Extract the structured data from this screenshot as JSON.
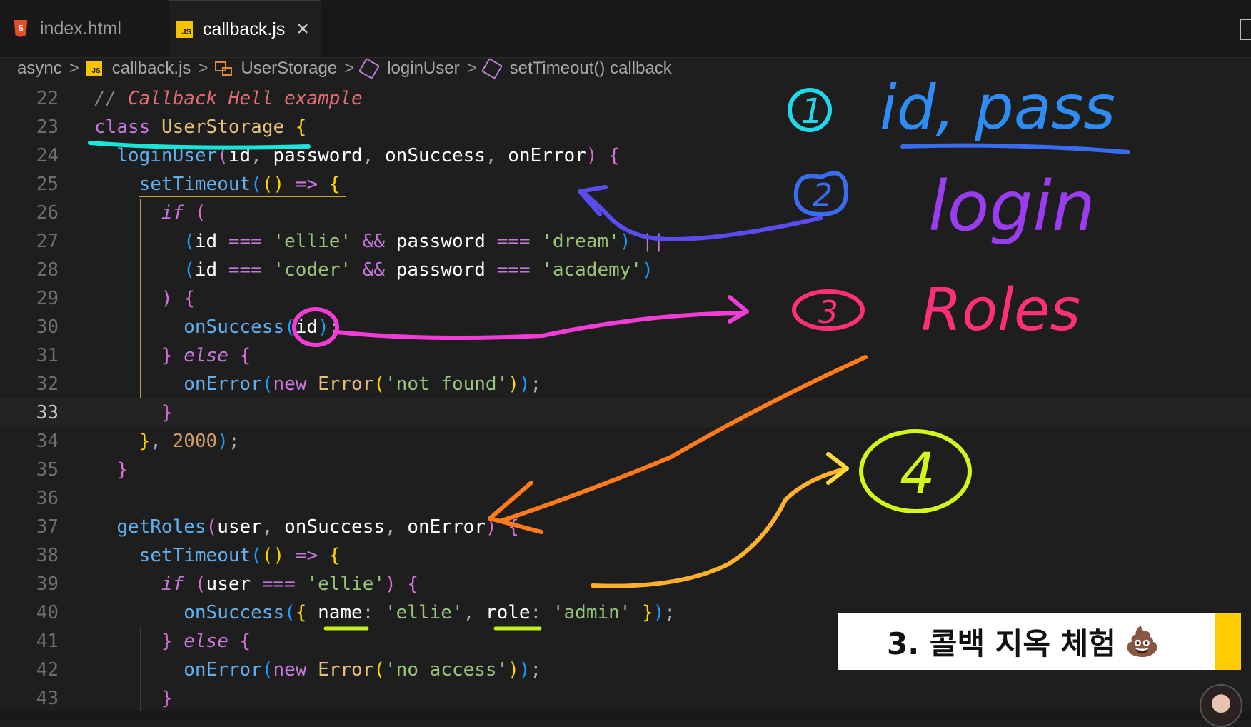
{
  "tabs": [
    {
      "label": "index.html",
      "icon": "html5-icon",
      "active": false
    },
    {
      "label": "callback.js",
      "icon": "js-file-icon",
      "active": true,
      "close": "×"
    }
  ],
  "breadcrumb": {
    "folder": "async",
    "file": "callback.js",
    "class_name": "UserStorage",
    "method": "loginUser",
    "callback": "setTimeout() callback",
    "separator": ">"
  },
  "code": {
    "line_numbers": [
      "22",
      "23",
      "24",
      "25",
      "26",
      "27",
      "28",
      "29",
      "30",
      "31",
      "32",
      "33",
      "34",
      "35",
      "36",
      "37",
      "38",
      "39",
      "40",
      "41",
      "42",
      "43"
    ],
    "current_line": "33",
    "comment_slashes": "//",
    "comment_text": "Callback Hell example",
    "kw_class": "class",
    "class_name": "UserStorage",
    "login_fn": "loginUser",
    "p_id": "id",
    "p_password": "password",
    "p_onSuccess": "onSuccess",
    "p_onError": "onError",
    "set_timeout": "setTimeout",
    "arrow": "=>",
    "kw_if": "if",
    "kw_else": "else",
    "kw_new": "new",
    "op_eq": "===",
    "op_and": "&&",
    "op_or": "||",
    "s_ellie": "'ellie'",
    "s_dream": "'dream'",
    "s_coder": "'coder'",
    "s_academy": "'academy'",
    "error_cls": "Error",
    "s_not_found": "'not found'",
    "n_2000": "2000",
    "roles_fn": "getRoles",
    "p_user": "user",
    "k_name": "name",
    "k_role": "role",
    "s_admin": "'admin'",
    "s_no_access": "'no access'"
  },
  "annotations": {
    "step1_number": "1",
    "step1_text": "id, pass",
    "step2_number": "2",
    "step2_text": "login",
    "step3_number": "3",
    "step3_text": "Roles",
    "step4_number": "4",
    "colors": {
      "cyan": "#20d8ea",
      "blue": "#3a6cf2",
      "purple": "#9a3cf0",
      "magenta": "#f23cd6",
      "pink": "#ff2f7a",
      "orange": "#ff7a1a",
      "yellow": "#d6f51a",
      "underline_cyan": "#17e6d8",
      "underline_yellow": "#c8f020"
    }
  },
  "caption": {
    "text": "3. 콜백 지옥 체험",
    "emoji": "💩",
    "accent": "#ffcc00"
  }
}
